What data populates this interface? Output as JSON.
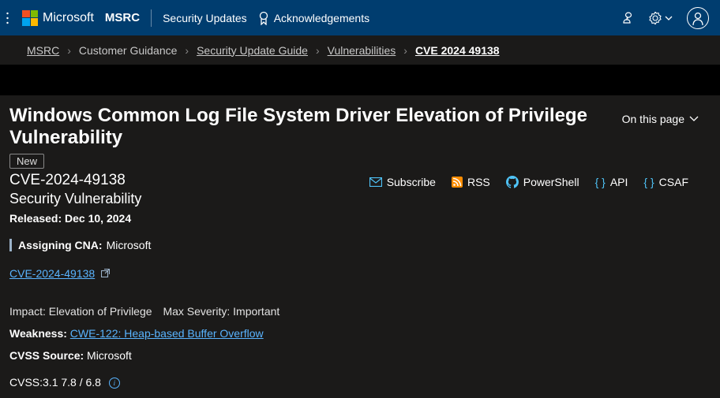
{
  "header": {
    "brand": "Microsoft",
    "msrc": "MSRC",
    "security_updates": "Security Updates",
    "acknowledgements": "Acknowledgements"
  },
  "breadcrumb": {
    "items": [
      {
        "label": "MSRC",
        "link": true,
        "current": false
      },
      {
        "label": "Customer Guidance",
        "link": false,
        "current": false
      },
      {
        "label": "Security Update Guide",
        "link": true,
        "current": false
      },
      {
        "label": "Vulnerabilities",
        "link": true,
        "current": false
      },
      {
        "label": "CVE 2024 49138",
        "link": true,
        "current": true
      }
    ]
  },
  "main": {
    "title": "Windows Common Log File System Driver Elevation of Privilege Vulnerability",
    "on_this_page": "On this page",
    "badge_new": "New",
    "cve_id": "CVE-2024-49138",
    "vuln_type": "Security Vulnerability",
    "actions": {
      "subscribe": "Subscribe",
      "rss": "RSS",
      "powershell": "PowerShell",
      "api": "API",
      "csaf": "CSAF"
    },
    "released_label": "Released: Dec 10, 2024",
    "cna_label": "Assigning CNA:",
    "cna_value": "Microsoft",
    "cve_link_text": "CVE-2024-49138",
    "impact_label": "Impact:",
    "impact_value": "Elevation of Privilege",
    "severity_label": "Max Severity:",
    "severity_value": "Important",
    "weakness_label": "Weakness:",
    "weakness_link": "CWE-122: Heap-based Buffer Overflow",
    "cvss_source_label": "CVSS Source:",
    "cvss_source_value": "Microsoft",
    "cvss_score": "CVSS:3.1 7.8 / 6.8"
  }
}
